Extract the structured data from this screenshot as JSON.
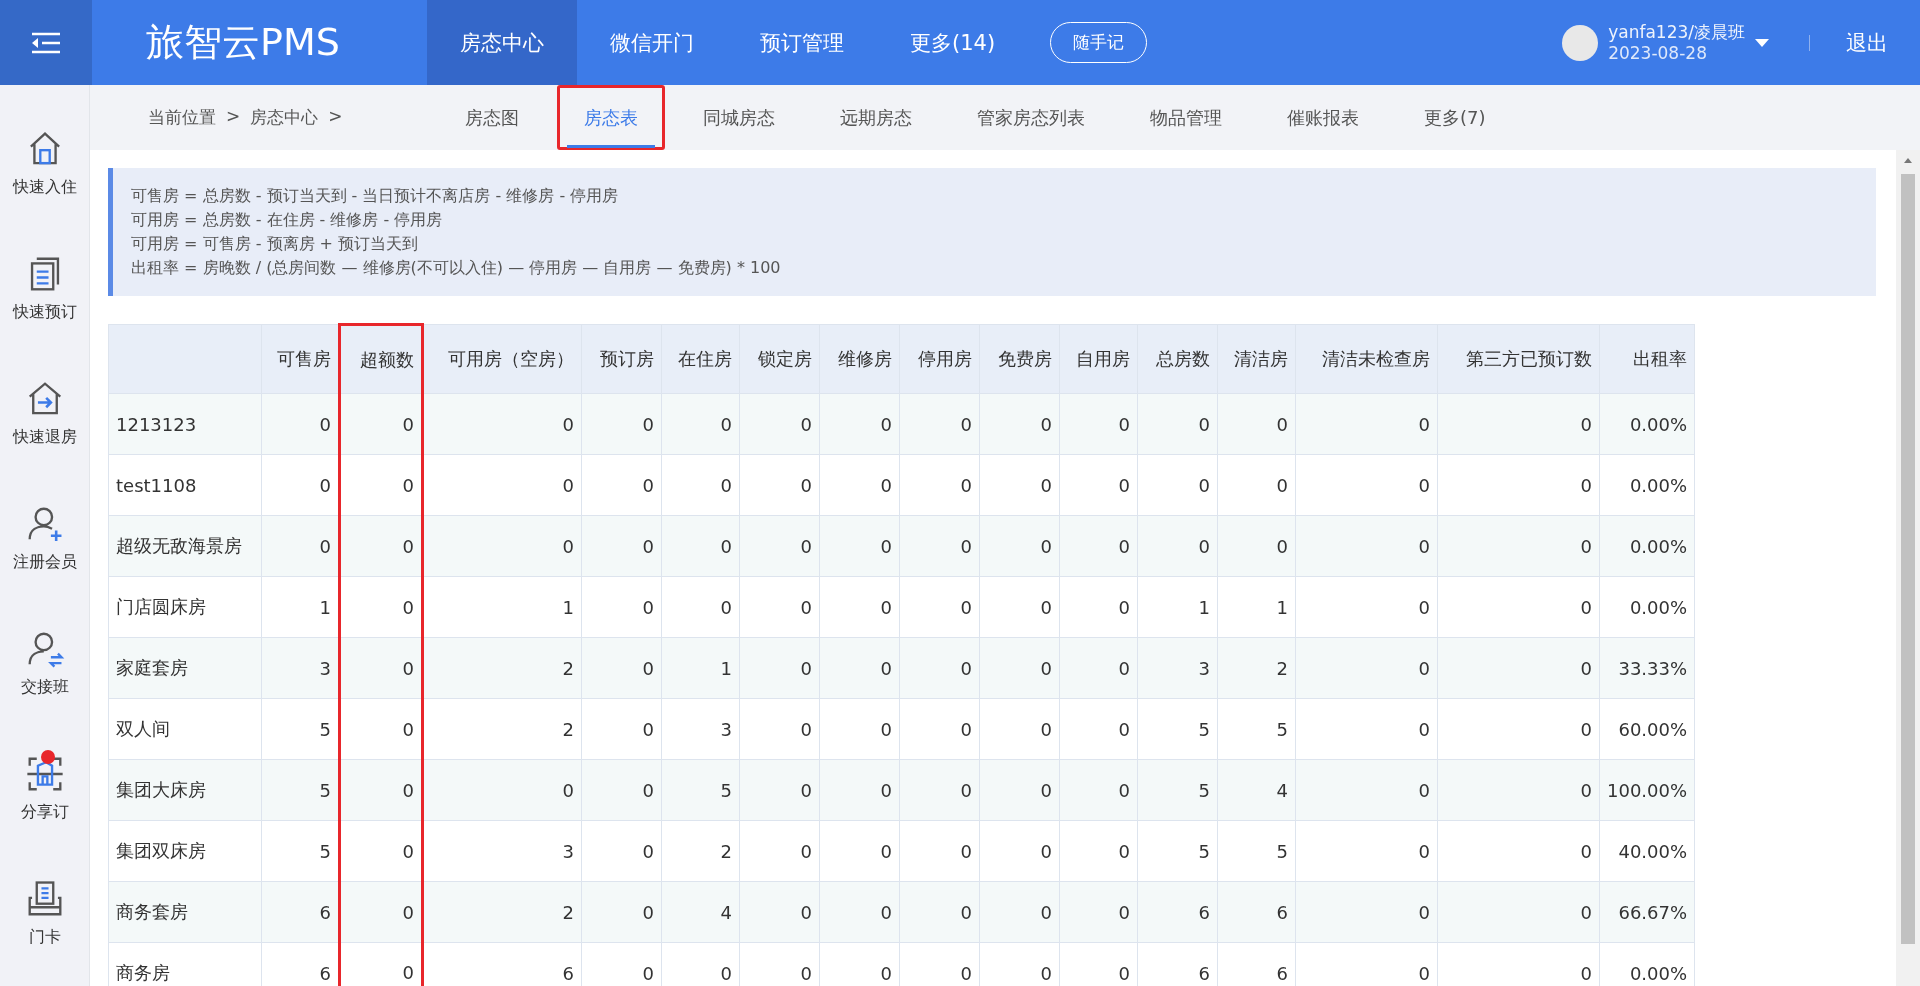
{
  "header": {
    "logo": "旅智云PMS",
    "nav": [
      {
        "label": "房态中心",
        "selected": true
      },
      {
        "label": "微信开门",
        "selected": false
      },
      {
        "label": "预订管理",
        "selected": false
      },
      {
        "label": "更多(14)",
        "selected": false
      }
    ],
    "note_button": "随手记",
    "user": {
      "name": "yanfa123/凌晨班",
      "date": "2023-08-28"
    },
    "logout": "退出"
  },
  "breadcrumb": [
    "当前位置",
    ">",
    "房态中心",
    ">"
  ],
  "tabs": [
    {
      "label": "房态图",
      "selected": false,
      "highlighted": false
    },
    {
      "label": "房态表",
      "selected": true,
      "highlighted": true
    },
    {
      "label": "同城房态",
      "selected": false,
      "highlighted": false
    },
    {
      "label": "远期房态",
      "selected": false,
      "highlighted": false
    },
    {
      "label": "管家房态列表",
      "selected": false,
      "highlighted": false
    },
    {
      "label": "物品管理",
      "selected": false,
      "highlighted": false
    },
    {
      "label": "催账报表",
      "selected": false,
      "highlighted": false
    },
    {
      "label": "更多(7)",
      "selected": false,
      "highlighted": false
    }
  ],
  "sidebar": {
    "items": [
      {
        "label": "快速入住",
        "badge": false
      },
      {
        "label": "快速预订",
        "badge": false
      },
      {
        "label": "快速退房",
        "badge": false
      },
      {
        "label": "注册会员",
        "badge": false
      },
      {
        "label": "交接班",
        "badge": false
      },
      {
        "label": "分享订",
        "badge": true
      },
      {
        "label": "门卡",
        "badge": false
      }
    ]
  },
  "formulas": [
    "可售房 = 总房数 - 预订当天到 - 当日预计不离店房 - 维修房 - 停用房",
    "可用房 = 总房数 - 在住房 - 维修房 - 停用房",
    "可用房 = 可售房 - 预离房 + 预订当天到",
    "出租率 = 房晚数 / (总房间数 — 维修房(不可以入住) — 停用房 — 自用房 — 免费房) * 100"
  ],
  "table": {
    "columns": [
      {
        "label": "可售房",
        "highlighted": false
      },
      {
        "label": "超额数",
        "highlighted": true
      },
      {
        "label": "可用房（空房）",
        "highlighted": false
      },
      {
        "label": "预订房",
        "highlighted": false
      },
      {
        "label": "在住房",
        "highlighted": false
      },
      {
        "label": "锁定房",
        "highlighted": false
      },
      {
        "label": "维修房",
        "highlighted": false
      },
      {
        "label": "停用房",
        "highlighted": false
      },
      {
        "label": "免费房",
        "highlighted": false
      },
      {
        "label": "自用房",
        "highlighted": false
      },
      {
        "label": "总房数",
        "highlighted": false
      },
      {
        "label": "清洁房",
        "highlighted": false
      },
      {
        "label": "清洁未检查房",
        "highlighted": false
      },
      {
        "label": "第三方已预订数",
        "highlighted": false
      },
      {
        "label": "出租率",
        "highlighted": false
      }
    ],
    "rows": [
      {
        "name": "1213123",
        "values": [
          "0",
          "0",
          "0",
          "0",
          "0",
          "0",
          "0",
          "0",
          "0",
          "0",
          "0",
          "0",
          "0",
          "0",
          "0.00%"
        ]
      },
      {
        "name": "test1108",
        "values": [
          "0",
          "0",
          "0",
          "0",
          "0",
          "0",
          "0",
          "0",
          "0",
          "0",
          "0",
          "0",
          "0",
          "0",
          "0.00%"
        ]
      },
      {
        "name": "超级无敌海景房",
        "values": [
          "0",
          "0",
          "0",
          "0",
          "0",
          "0",
          "0",
          "0",
          "0",
          "0",
          "0",
          "0",
          "0",
          "0",
          "0.00%"
        ]
      },
      {
        "name": "门店圆床房",
        "values": [
          "1",
          "0",
          "1",
          "0",
          "0",
          "0",
          "0",
          "0",
          "0",
          "0",
          "1",
          "1",
          "0",
          "0",
          "0.00%"
        ]
      },
      {
        "name": "家庭套房",
        "values": [
          "3",
          "0",
          "2",
          "0",
          "1",
          "0",
          "0",
          "0",
          "0",
          "0",
          "3",
          "2",
          "0",
          "0",
          "33.33%"
        ]
      },
      {
        "name": "双人间",
        "values": [
          "5",
          "0",
          "2",
          "0",
          "3",
          "0",
          "0",
          "0",
          "0",
          "0",
          "5",
          "5",
          "0",
          "0",
          "60.00%"
        ]
      },
      {
        "name": "集团大床房",
        "values": [
          "5",
          "0",
          "0",
          "0",
          "5",
          "0",
          "0",
          "0",
          "0",
          "0",
          "5",
          "4",
          "0",
          "0",
          "100.00%"
        ]
      },
      {
        "name": "集团双床房",
        "values": [
          "5",
          "0",
          "3",
          "0",
          "2",
          "0",
          "0",
          "0",
          "0",
          "0",
          "5",
          "5",
          "0",
          "0",
          "40.00%"
        ]
      },
      {
        "name": "商务套房",
        "values": [
          "6",
          "0",
          "2",
          "0",
          "4",
          "0",
          "0",
          "0",
          "0",
          "0",
          "6",
          "6",
          "0",
          "0",
          "66.67%"
        ]
      },
      {
        "name": "商务房",
        "values": [
          "6",
          "0",
          "6",
          "0",
          "0",
          "0",
          "0",
          "0",
          "0",
          "0",
          "6",
          "6",
          "0",
          "0",
          "0.00%"
        ]
      }
    ]
  }
}
